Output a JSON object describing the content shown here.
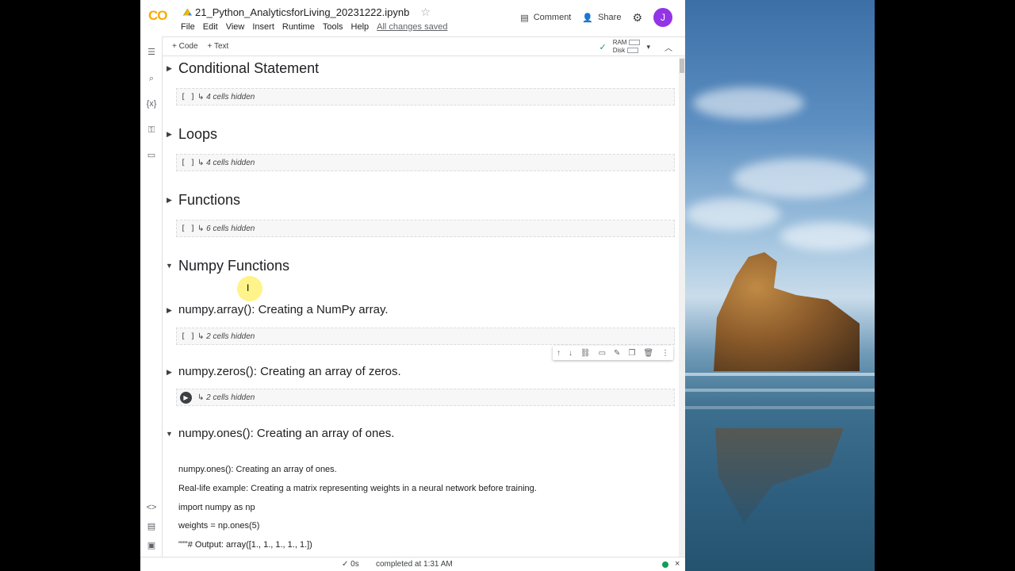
{
  "header": {
    "logo": "CO",
    "notebook_title": "21_Python_AnalyticsforLiving_20231222.ipynb",
    "menu": [
      "File",
      "Edit",
      "View",
      "Insert",
      "Runtime",
      "Tools",
      "Help"
    ],
    "saved_status": "All changes saved",
    "comment_label": "Comment",
    "share_label": "Share",
    "avatar_initial": "J"
  },
  "toolbar": {
    "code_label": "+ Code",
    "text_label": "+ Text",
    "ram_label": "RAM",
    "disk_label": "Disk"
  },
  "sections": {
    "conditional": {
      "title": "Conditional Statement",
      "hidden": "4 cells hidden"
    },
    "loops": {
      "title": "Loops",
      "hidden": "4 cells hidden"
    },
    "functions": {
      "title": "Functions",
      "hidden": "6 cells hidden"
    },
    "numpy": {
      "title": "Numpy Functions"
    },
    "np_array": {
      "title": "numpy.array(): Creating a NumPy array.",
      "hidden": "2 cells hidden"
    },
    "np_zeros": {
      "title": "numpy.zeros(): Creating an array of zeros.",
      "hidden": "2 cells hidden"
    },
    "np_ones": {
      "title": "numpy.ones(): Creating an array of ones.",
      "lines": [
        "numpy.ones(): Creating an array of ones.",
        "Real-life example: Creating a matrix representing weights in a neural network before training.",
        "import numpy as np",
        "weights = np.ones(5)",
        "\"\"\"# Output: array([1., 1., 1., 1., 1.])"
      ]
    }
  },
  "cell_bracket": "[ ]",
  "status": {
    "check": "✓",
    "time": "0s",
    "completed": "completed at 1:31 AM",
    "close": "×"
  }
}
